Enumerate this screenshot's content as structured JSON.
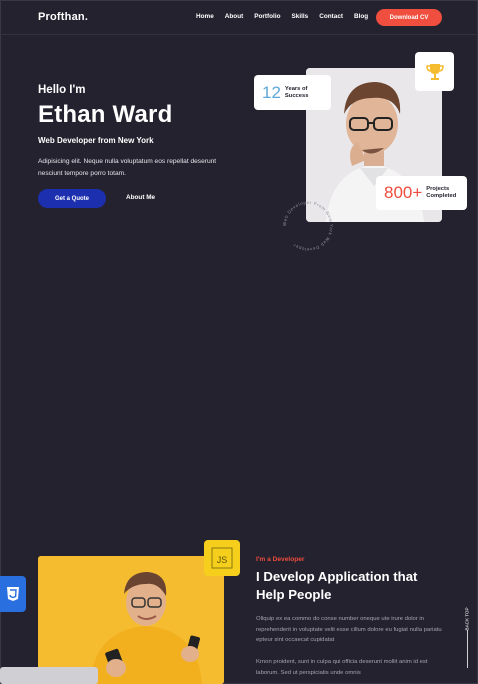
{
  "header": {
    "logo": "Profthan.",
    "nav": [
      "Home",
      "About",
      "Portfolio",
      "Skills",
      "Contact",
      "Blog"
    ],
    "download_label": "Download CV"
  },
  "hero": {
    "greeting": "Hello I'm",
    "name": "Ethan Ward",
    "role": "Web Developer from New York",
    "description": "Adipisicing elit. Neque nulla voluptatum eos repellat deserunt nesciunt tempore porro totam.",
    "quote_button": "Get a Quote",
    "about_link": "About Me",
    "years_number": "12",
    "years_label_1": "Years of",
    "years_label_2": "Success",
    "projects_number": "800+",
    "projects_label_1": "Projects",
    "projects_label_2": "Completed",
    "circle_text": "Web Developer From New York Web Developer"
  },
  "about": {
    "tag": "I'm a Developer",
    "title": "I Develop Application that Help People",
    "para1": "Ollquip ex ea commo do conse number oneque ute irure dolor in reprehenderit in voluptate velit esse cillum dolore eu fugiat nulla pariatu epteur sint occaecat cupidatat",
    "para2": "Krnon proident, sunt in culpa qui officia deserunt mollit anim id est laborum. Sed ut perspiciatis unde omnis",
    "js_label": "JS",
    "back_top": "BACK TOP"
  },
  "colors": {
    "background": "#24222f",
    "accent": "#f04e3e",
    "primary_button": "#1c2fae",
    "highlight": "#f6bc30"
  }
}
